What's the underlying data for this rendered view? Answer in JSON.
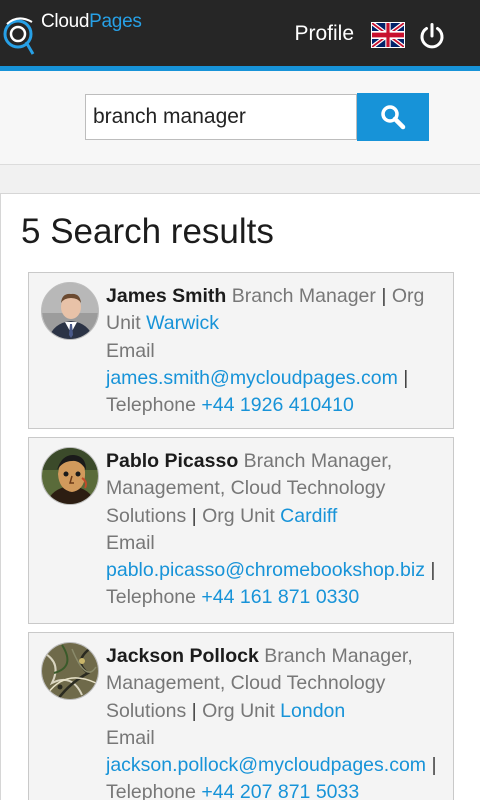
{
  "header": {
    "logo_cloud": "Cloud",
    "logo_pages": "Pages",
    "profile_label": "Profile",
    "language_flag": "uk-flag-icon",
    "logout_icon": "power-icon"
  },
  "search": {
    "query": "branch manager",
    "button_icon": "search-icon"
  },
  "results": {
    "title": "5 Search results",
    "items": [
      {
        "name": "James Smith",
        "role": "Branch Manager",
        "sep1": "|",
        "org_unit_label": "Org Unit",
        "org_unit": "Warwick",
        "email_label": "Email",
        "email": "james.smith@mycloudpages.com",
        "sep2": "|",
        "telephone_label": "Telephone",
        "telephone": "+44 1926 410410"
      },
      {
        "name": "Pablo Picasso",
        "role": "Branch Manager, Management, Cloud Technology Solutions",
        "sep1": "|",
        "org_unit_label": "Org Unit",
        "org_unit": "Cardiff",
        "email_label": "Email",
        "email": "pablo.picasso@chromebookshop.biz",
        "sep2": "|",
        "telephone_label": "Telephone",
        "telephone": "+44 161 871 0330"
      },
      {
        "name": "Jackson Pollock",
        "role": "Branch Manager, Management, Cloud Technology Solutions",
        "sep1": "|",
        "org_unit_label": "Org Unit",
        "org_unit": "London",
        "email_label": "Email",
        "email": "jackson.pollock@mycloudpages.com",
        "sep2": "|",
        "telephone_label": "Telephone",
        "telephone": "+44 207 871 5033"
      }
    ]
  },
  "colors": {
    "accent": "#1793d8",
    "header_bg": "#262626"
  }
}
